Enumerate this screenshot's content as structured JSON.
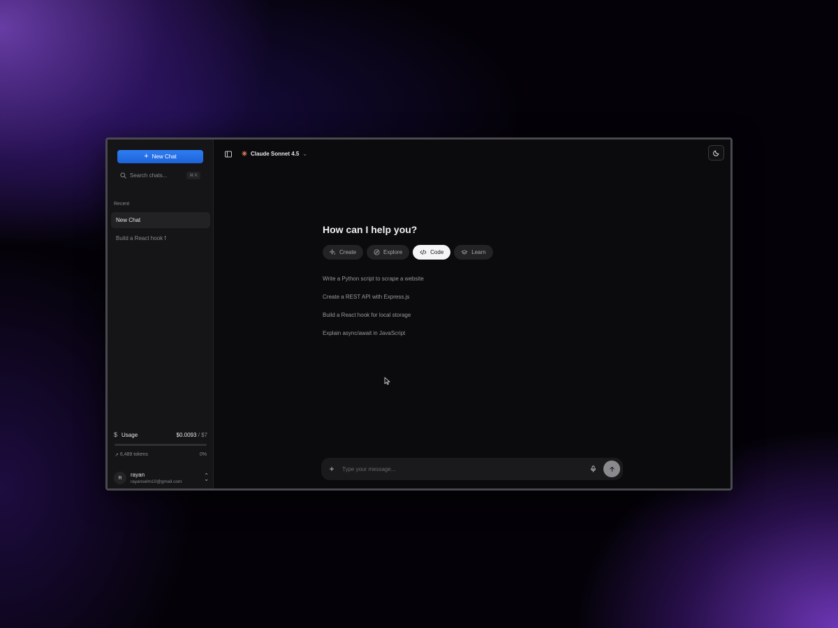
{
  "sidebar": {
    "new_chat_label": "New Chat",
    "search_placeholder": "Search chats...",
    "search_shortcut": "⌘ K",
    "recent_label": "Recent",
    "chats": [
      {
        "title": "New Chat",
        "active": true
      },
      {
        "title": "Build a React hook f",
        "active": false
      }
    ],
    "usage": {
      "label": "Usage",
      "cost": "$0.0093",
      "limit": " / $7",
      "progress_percent": 0,
      "tokens": "6,489 tokens",
      "percent_text": "0%"
    },
    "user": {
      "initial": "R",
      "name": "rayan",
      "email": "rayanselm10@gmail.com"
    }
  },
  "header": {
    "model_name": "Claude Sonnet 4.5"
  },
  "main": {
    "heading": "How can I help you?",
    "categories": [
      {
        "label": "Create",
        "icon": "sparkles-icon",
        "active": false
      },
      {
        "label": "Explore",
        "icon": "compass-icon",
        "active": false
      },
      {
        "label": "Code",
        "icon": "code-icon",
        "active": true
      },
      {
        "label": "Learn",
        "icon": "graduation-cap-icon",
        "active": false
      }
    ],
    "suggestions": [
      "Write a Python script to scrape a website",
      "Create a REST API with Express.js",
      "Build a React hook for local storage",
      "Explain async/await in JavaScript"
    ]
  },
  "composer": {
    "placeholder": "Type your message..."
  },
  "colors": {
    "accent": "#2f7df3",
    "window_bg": "#0b0b0d",
    "sidebar_bg": "#151517"
  }
}
